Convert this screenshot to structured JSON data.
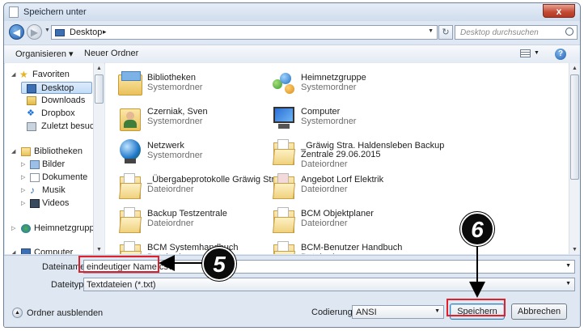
{
  "window": {
    "title": "Speichern unter",
    "close_label": "x"
  },
  "address_bar": {
    "back_icon": "back-arrow-icon",
    "path": "Desktop",
    "separator": "▸",
    "search_placeholder": "Desktop durchsuchen"
  },
  "toolbar": {
    "organize_label": "Organisieren ▾",
    "new_folder_label": "Neuer Ordner",
    "help_label": "?"
  },
  "nav": {
    "items": [
      {
        "label": "Favoriten",
        "icon": "star-icon"
      },
      {
        "label": "Desktop",
        "icon": "desktop-icon",
        "selected": true
      },
      {
        "label": "Downloads",
        "icon": "downloads-icon"
      },
      {
        "label": "Dropbox",
        "icon": "dropbox-icon"
      },
      {
        "label": "Zuletzt besucht",
        "icon": "recent-places-icon"
      },
      {
        "label": "Bibliotheken",
        "icon": "libraries-icon"
      },
      {
        "label": "Bilder",
        "icon": "pictures-icon"
      },
      {
        "label": "Dokumente",
        "icon": "documents-icon"
      },
      {
        "label": "Musik",
        "icon": "music-icon"
      },
      {
        "label": "Videos",
        "icon": "videos-icon"
      },
      {
        "label": "Heimnetzgruppe",
        "icon": "homegroup-icon"
      },
      {
        "label": "Computer",
        "icon": "computer-icon"
      }
    ]
  },
  "files": [
    {
      "name": "Bibliotheken",
      "type": "Systemordner",
      "icon": "libraries-icon"
    },
    {
      "name": "Heimnetzgruppe",
      "type": "Systemordner",
      "icon": "homegroup-icon"
    },
    {
      "name": "Czerniak, Sven",
      "type": "Systemordner",
      "icon": "user-folder-icon"
    },
    {
      "name": "Computer",
      "type": "Systemordner",
      "icon": "computer-icon"
    },
    {
      "name": "Netzwerk",
      "type": "Systemordner",
      "icon": "network-icon"
    },
    {
      "name": "_Gräwig Stra. Haldensleben Backup",
      "name_line2": "Zentrale 29.06.2015",
      "type": "Dateiordner",
      "icon": "folder-icon"
    },
    {
      "name": "_Übergabeprotokolle Gräwig Str",
      "type": "Dateiordner",
      "icon": "folder-icon"
    },
    {
      "name": "Angebot Lorf Elektrik",
      "type": "Dateiordner",
      "icon": "folder-icon"
    },
    {
      "name": "Backup Testzentrale",
      "type": "Dateiordner",
      "icon": "folder-icon"
    },
    {
      "name": "BCM Objektplaner",
      "type": "Dateiordner",
      "icon": "folder-icon"
    },
    {
      "name": "BCM Systemhandbuch",
      "type": "Dateiordner",
      "icon": "folder-icon"
    },
    {
      "name": "BCM-Benutzer Handbuch",
      "type": "Dateiordner",
      "icon": "folder-icon"
    }
  ],
  "form": {
    "filename_label": "Dateiname:",
    "filename_value": "eindeutiger Name.csv",
    "filetype_label": "Dateityp:",
    "filetype_value": "Textdateien (*.txt)",
    "hide_folders_label": "Ordner ausblenden",
    "encoding_label": "Codierung:",
    "encoding_value": "ANSI",
    "save_label": "Speichern",
    "cancel_label": "Abbrechen"
  },
  "annotations": {
    "step5": "5",
    "step6": "6",
    "highlight_color": "#e0202a"
  }
}
